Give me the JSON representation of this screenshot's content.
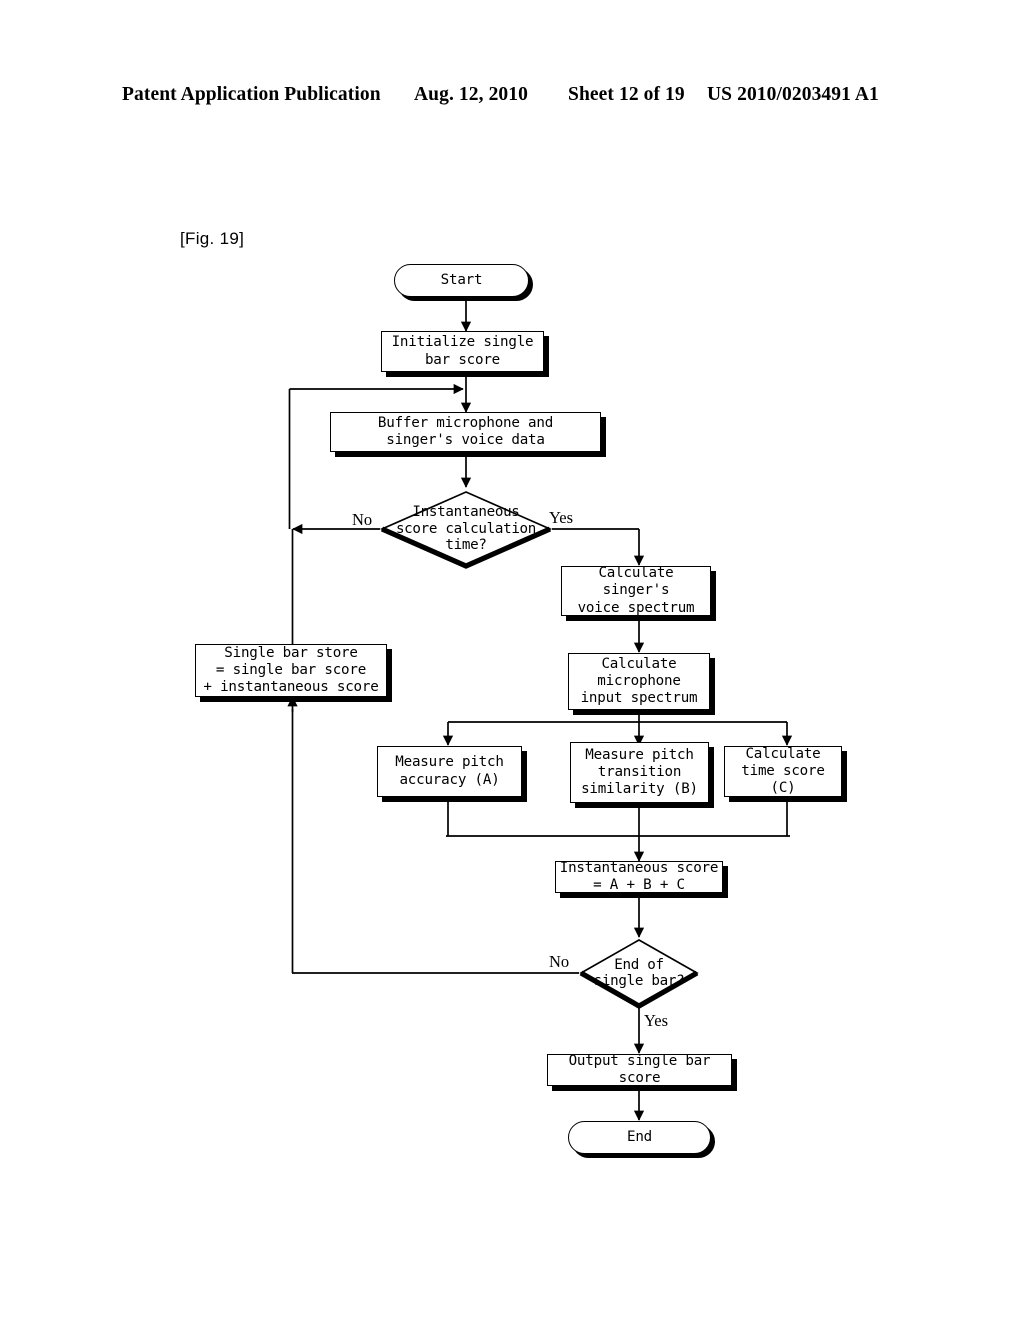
{
  "header": {
    "publication": "Patent Application Publication",
    "date": "Aug. 12, 2010",
    "sheet": "Sheet 12 of 19",
    "patent_number": "US 2010/0203491 A1"
  },
  "figure": {
    "label": "[Fig. 19]"
  },
  "flowchart": {
    "nodes": {
      "start": "Start",
      "init": "Initialize single\nbar score",
      "buffer": "Buffer microphone and\nsinger's voice data",
      "decision_calc_time": "Instantaneous\nscore calculation\ntime?",
      "calc_singer_spectrum": "Calculate singer's\nvoice spectrum",
      "calc_mic_spectrum": "Calculate\nmicrophone\ninput spectrum",
      "single_bar_store": "Single bar store\n= single bar score\n+ instantaneous score",
      "measure_pitch_accuracy": "Measure pitch\naccuracy (A)",
      "measure_pitch_transition": "Measure pitch\ntransition\nsimilarity (B)",
      "calculate_time_score": "Calculate\ntime score (C)",
      "instantaneous_score": "Instantaneous score\n= A + B + C",
      "decision_end_bar": "End of\nsingle bar?",
      "output": "Output single bar score",
      "end": "End"
    },
    "branch_labels": {
      "calc_time_no": "No",
      "calc_time_yes": "Yes",
      "end_bar_no": "No",
      "end_bar_yes": "Yes"
    },
    "colors": {
      "line": "#000000",
      "fill": "#ffffff",
      "shadow": "#000000"
    }
  }
}
